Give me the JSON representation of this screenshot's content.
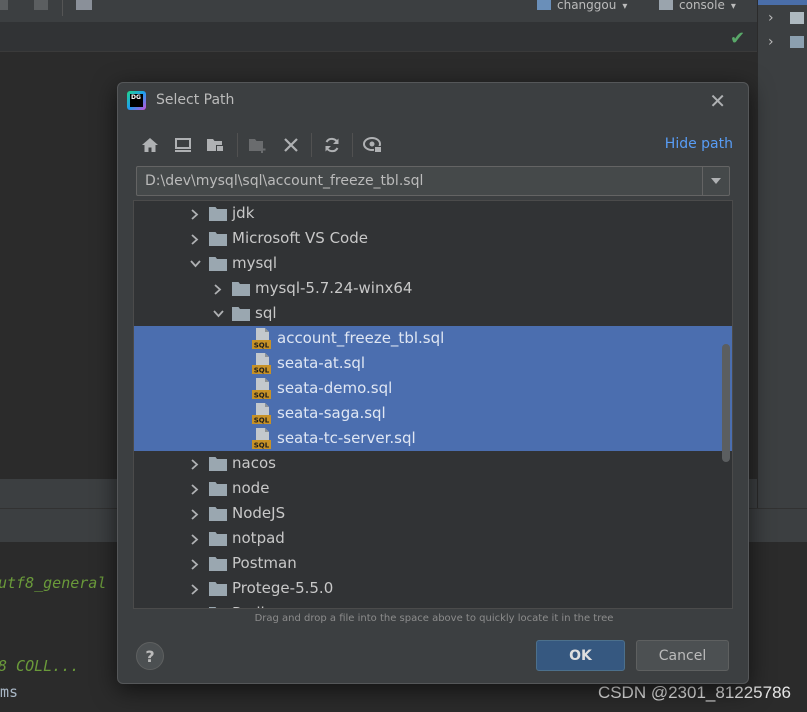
{
  "ide": {
    "project_label": "changgou",
    "console_label": "console",
    "console_lines": [
      "utf8_general",
      "8 COLL...",
      "ms"
    ]
  },
  "watermark": "CSDN @2301_81225786",
  "dialog": {
    "title": "Select Path",
    "hide_path_label": "Hide path",
    "path_value": "D:\\dev\\mysql\\sql\\account_freeze_tbl.sql",
    "toolbar_icons": [
      "home-icon",
      "desktop-icon",
      "project-folder-icon",
      "new-folder-icon",
      "delete-icon",
      "refresh-icon",
      "show-hidden-icon"
    ],
    "tree": [
      {
        "label": "jdk",
        "depth": 0,
        "type": "folder",
        "expanded": false,
        "selected": false
      },
      {
        "label": "Microsoft VS Code",
        "depth": 0,
        "type": "folder",
        "expanded": false,
        "selected": false
      },
      {
        "label": "mysql",
        "depth": 0,
        "type": "folder",
        "expanded": true,
        "selected": false
      },
      {
        "label": "mysql-5.7.24-winx64",
        "depth": 1,
        "type": "folder",
        "expanded": false,
        "selected": false
      },
      {
        "label": "sql",
        "depth": 1,
        "type": "folder",
        "expanded": true,
        "selected": false
      },
      {
        "label": "account_freeze_tbl.sql",
        "depth": 2,
        "type": "sql",
        "selected": true
      },
      {
        "label": "seata-at.sql",
        "depth": 2,
        "type": "sql",
        "selected": true
      },
      {
        "label": "seata-demo.sql",
        "depth": 2,
        "type": "sql",
        "selected": true
      },
      {
        "label": "seata-saga.sql",
        "depth": 2,
        "type": "sql",
        "selected": true
      },
      {
        "label": "seata-tc-server.sql",
        "depth": 2,
        "type": "sql",
        "selected": true
      },
      {
        "label": "nacos",
        "depth": 0,
        "type": "folder",
        "expanded": false,
        "selected": false
      },
      {
        "label": "node",
        "depth": 0,
        "type": "folder",
        "expanded": false,
        "selected": false
      },
      {
        "label": "NodeJS",
        "depth": 0,
        "type": "folder",
        "expanded": false,
        "selected": false
      },
      {
        "label": "notpad",
        "depth": 0,
        "type": "folder",
        "expanded": false,
        "selected": false
      },
      {
        "label": "Postman",
        "depth": 0,
        "type": "folder",
        "expanded": false,
        "selected": false
      },
      {
        "label": "Protege-5.5.0",
        "depth": 0,
        "type": "folder",
        "expanded": false,
        "selected": false
      },
      {
        "label": "Redis",
        "depth": 0,
        "type": "folder",
        "expanded": false,
        "selected": false
      }
    ],
    "hint": "Drag and drop a file into the space above to quickly locate it in the tree",
    "help_label": "?",
    "ok_label": "OK",
    "cancel_label": "Cancel"
  },
  "colors": {
    "selection": "#4b6eaf",
    "link": "#589df6",
    "ok_button": "#365880"
  }
}
